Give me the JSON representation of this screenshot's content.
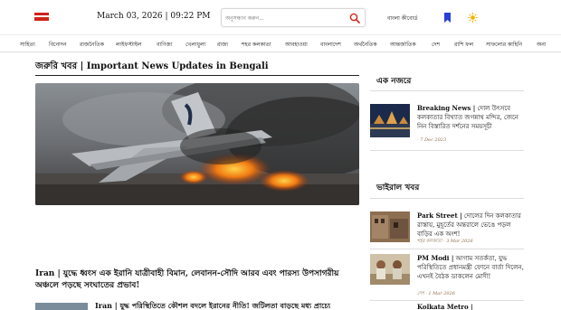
{
  "header": {
    "logo_label": "",
    "date": "March 03, 2026 | 09:22 PM",
    "search_placeholder": "অনুসন্ধান করুন...",
    "language": "বাংলা কীবোর্ড"
  },
  "nav": {
    "items": [
      "সাহিত্য",
      "বিনোদন",
      "রাজনৈতিক",
      "লাইফস্টাইল",
      "বাণিজ্য",
      "খেলাধুলা",
      "রাজ্য",
      "শহর কলকাতা",
      "আবহাওয়া",
      "বাংলাদেশ",
      "অর্থনৈতিক",
      "আন্তর্জাতিক",
      "দেশ",
      "রাশি ফল",
      "সাফল্যের কাহিনি",
      "অন্য"
    ]
  },
  "main": {
    "section_title": "জরুরি খবর | Important News Updates in Bengali",
    "lead_headline": "Iran | যুদ্ধে ধ্বংস এক ইরানি যাত্রীবাহী বিমান, লেবানন-সৌদি আরব এবং পারস্য উপসাগরীয় অঞ্চলে পড়ছে সংঘাতের প্রভাব!",
    "second_headline": "Iran | যুদ্ধ পরিস্থিতিতে কৌশল বদলে ইরানের নীতি! জটিলতা বাড়ছে মধ্য প্রাচ্যে"
  },
  "sidebar": {
    "glance_title": "এক নজরে",
    "glance_card": {
      "title_en": "Breaking News |",
      "title_bn": "দোল উৎসবে কলকাতার বিখ্যাত জগন্নাথ মন্দির, জেনে নিন বিস্তারিত দর্শনের সময়সূচী",
      "meta": "- 7 Dec 2023"
    },
    "viral_title": "ভাইরাল খবর",
    "viral_cards": [
      {
        "title_en": "Park Street |",
        "title_bn": "দোলের দিন কলকাতার রাস্তায়, মুহূর্তের অন্তরালে ভেঙে পড়ল বাড়ির এক অংশ!",
        "meta": "শহর কলকাতা · 3 Mar 2026"
      },
      {
        "title_en": "PM Modi |",
        "title_bn": "আগাম সতর্কতা, যুদ্ধ পরিস্থিতিতে প্রধানমন্ত্রী ফোনে বার্তা দিলেন, এখনই বৈঠক ডাকলেন মোদী!",
        "meta": "দেশ · 1 Mar 2026"
      },
      {
        "title_en": "Kolkata Metro |",
        "title_bn": "",
        "meta": ""
      }
    ]
  },
  "colors": {
    "accent_red": "#d0231b",
    "bookmark_blue": "#2b3fd6",
    "sun_yellow": "#f3b100",
    "meta_brown": "#8a6b4a"
  }
}
